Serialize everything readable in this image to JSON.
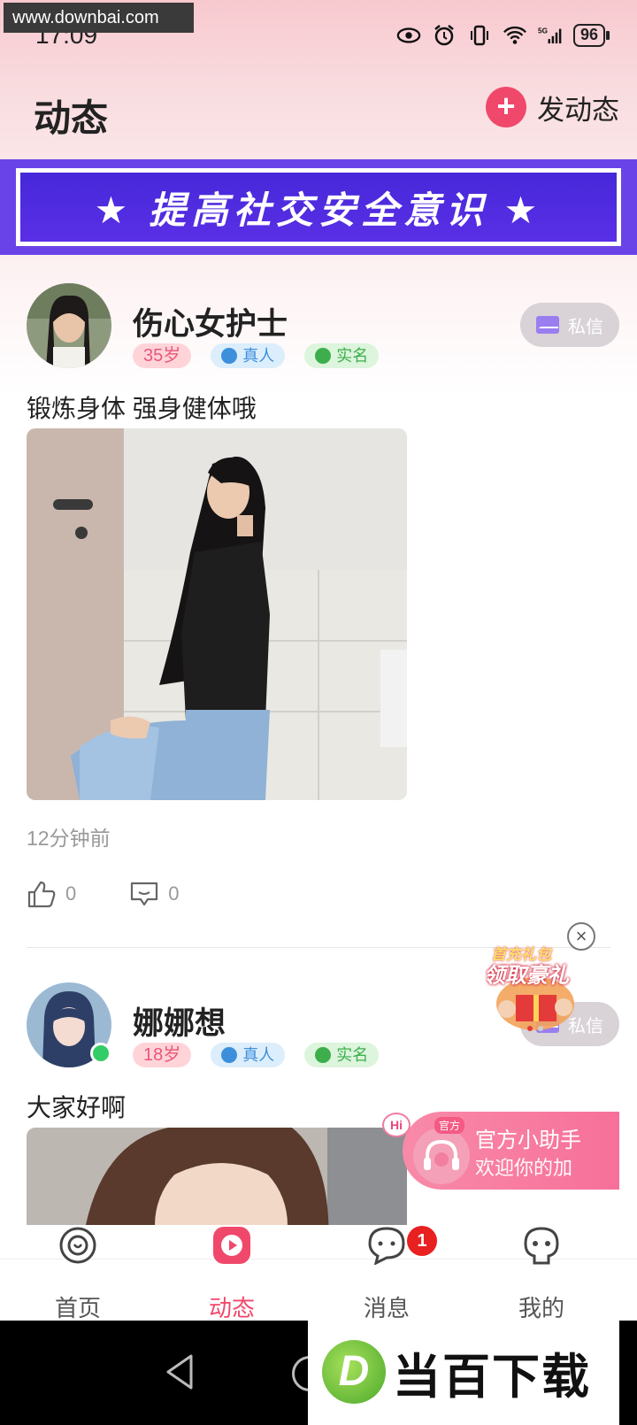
{
  "watermark": {
    "top_left": "www.downbai.com",
    "bottom_right": "当百下载"
  },
  "status_bar": {
    "time": "17:09",
    "battery": "96",
    "icons": [
      "eye-icon",
      "alarm-icon",
      "vibrate-icon",
      "wifi-icon",
      "signal-5g-icon"
    ]
  },
  "header": {
    "title": "动态",
    "post_button_label": "发动态",
    "post_icon": "plus-icon"
  },
  "banner": {
    "text": "★ 提高社交安全意识 ★"
  },
  "posts": [
    {
      "username": "伤心女护士",
      "age": "35岁",
      "tag_real": "真人",
      "tag_name": "实名",
      "dm_label": "私信",
      "text": "锻炼身体 强身健体哦",
      "time": "12分钟前",
      "likes": "0",
      "comments": "0"
    },
    {
      "username": "娜娜想",
      "age": "18岁",
      "tag_real": "真人",
      "tag_name": "实名",
      "dm_label": "私信",
      "text": "大家好啊"
    }
  ],
  "promo": {
    "line1": "首充礼包",
    "line2": "领取豪礼",
    "close": "×"
  },
  "assistant": {
    "hi": "Hi",
    "tag": "官方",
    "title": "官方小助手",
    "subtitle": "欢迎你的加"
  },
  "tabs": [
    {
      "label": "首页",
      "icon": "home-icon",
      "active": false
    },
    {
      "label": "动态",
      "icon": "play-icon",
      "active": true
    },
    {
      "label": "消息",
      "icon": "message-icon",
      "active": false,
      "badge": "1"
    },
    {
      "label": "我的",
      "icon": "profile-icon",
      "active": false
    }
  ],
  "colors": {
    "accent": "#f0486b",
    "banner": "#4628d9",
    "badge": "#e8201f"
  }
}
